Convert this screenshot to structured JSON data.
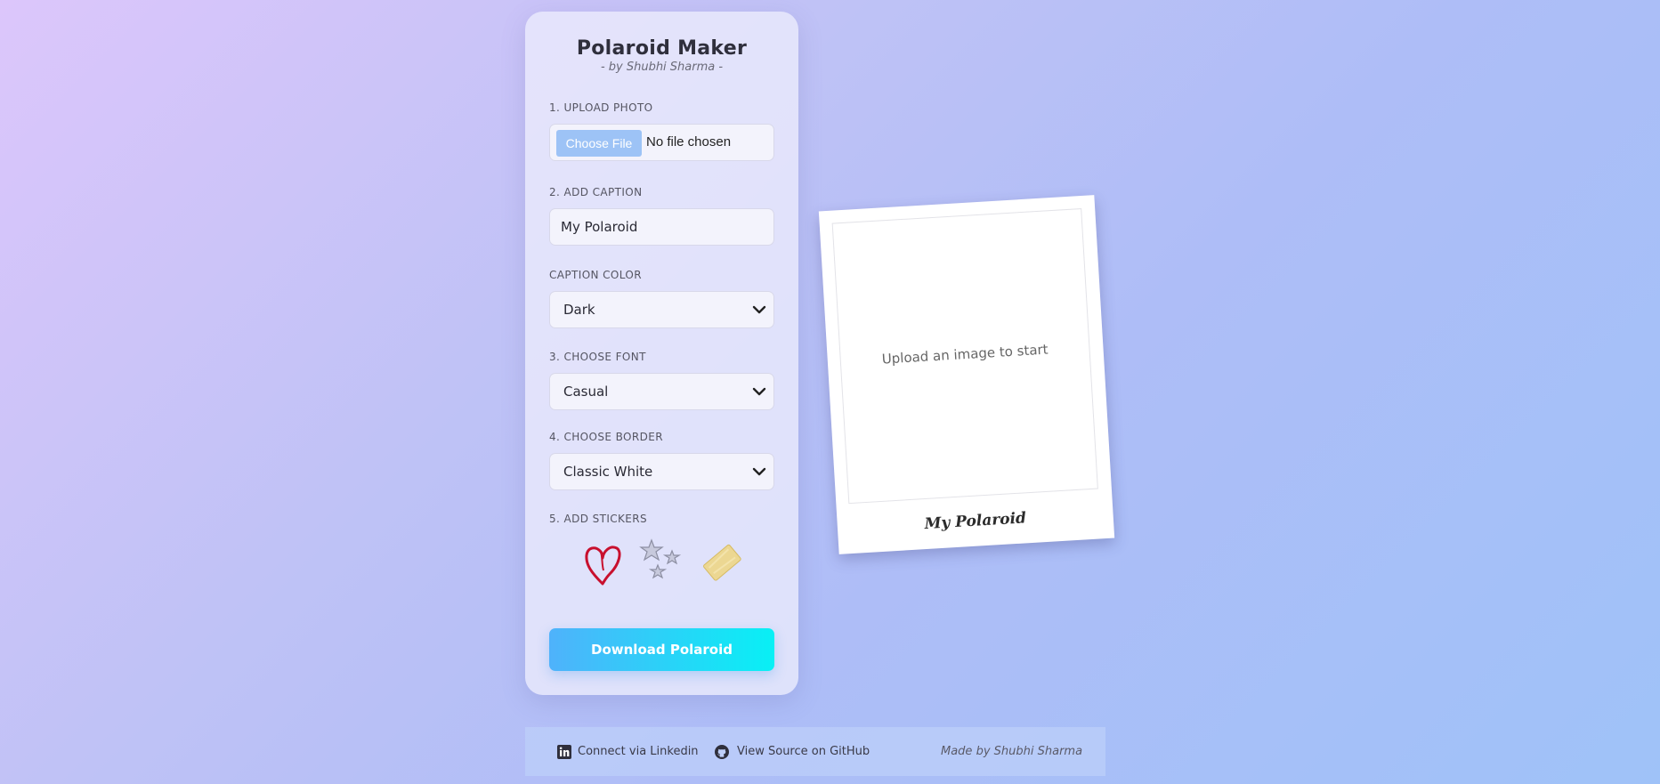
{
  "app": {
    "title": "Polaroid Maker",
    "subtitle": "- by Shubhi Sharma -"
  },
  "form": {
    "upload": {
      "label": "1. UPLOAD PHOTO",
      "button_label": "Choose File",
      "status": "No file chosen"
    },
    "caption": {
      "label": "2. ADD CAPTION",
      "value": "My Polaroid"
    },
    "caption_color": {
      "label": "CAPTION COLOR",
      "selected": "Dark"
    },
    "font": {
      "label": "3. CHOOSE FONT",
      "selected": "Casual"
    },
    "border": {
      "label": "4. CHOOSE BORDER",
      "selected": "Classic White"
    },
    "stickers": {
      "label": "5. ADD STICKERS",
      "items": [
        "heart-sticker",
        "stars-sticker",
        "tape-sticker"
      ]
    },
    "download_label": "Download Polaroid"
  },
  "preview": {
    "placeholder": "Upload an image to start",
    "caption": "My Polaroid"
  },
  "footer": {
    "linkedin_label": "Connect via Linkedin",
    "github_label": "View Source on GitHub",
    "made_by": "Made by Shubhi Sharma"
  },
  "colors": {
    "accent_start": "#4fb2fb",
    "accent_end": "#08f0f5",
    "file_button": "#9dc3f6",
    "heart": "#c8102e"
  }
}
